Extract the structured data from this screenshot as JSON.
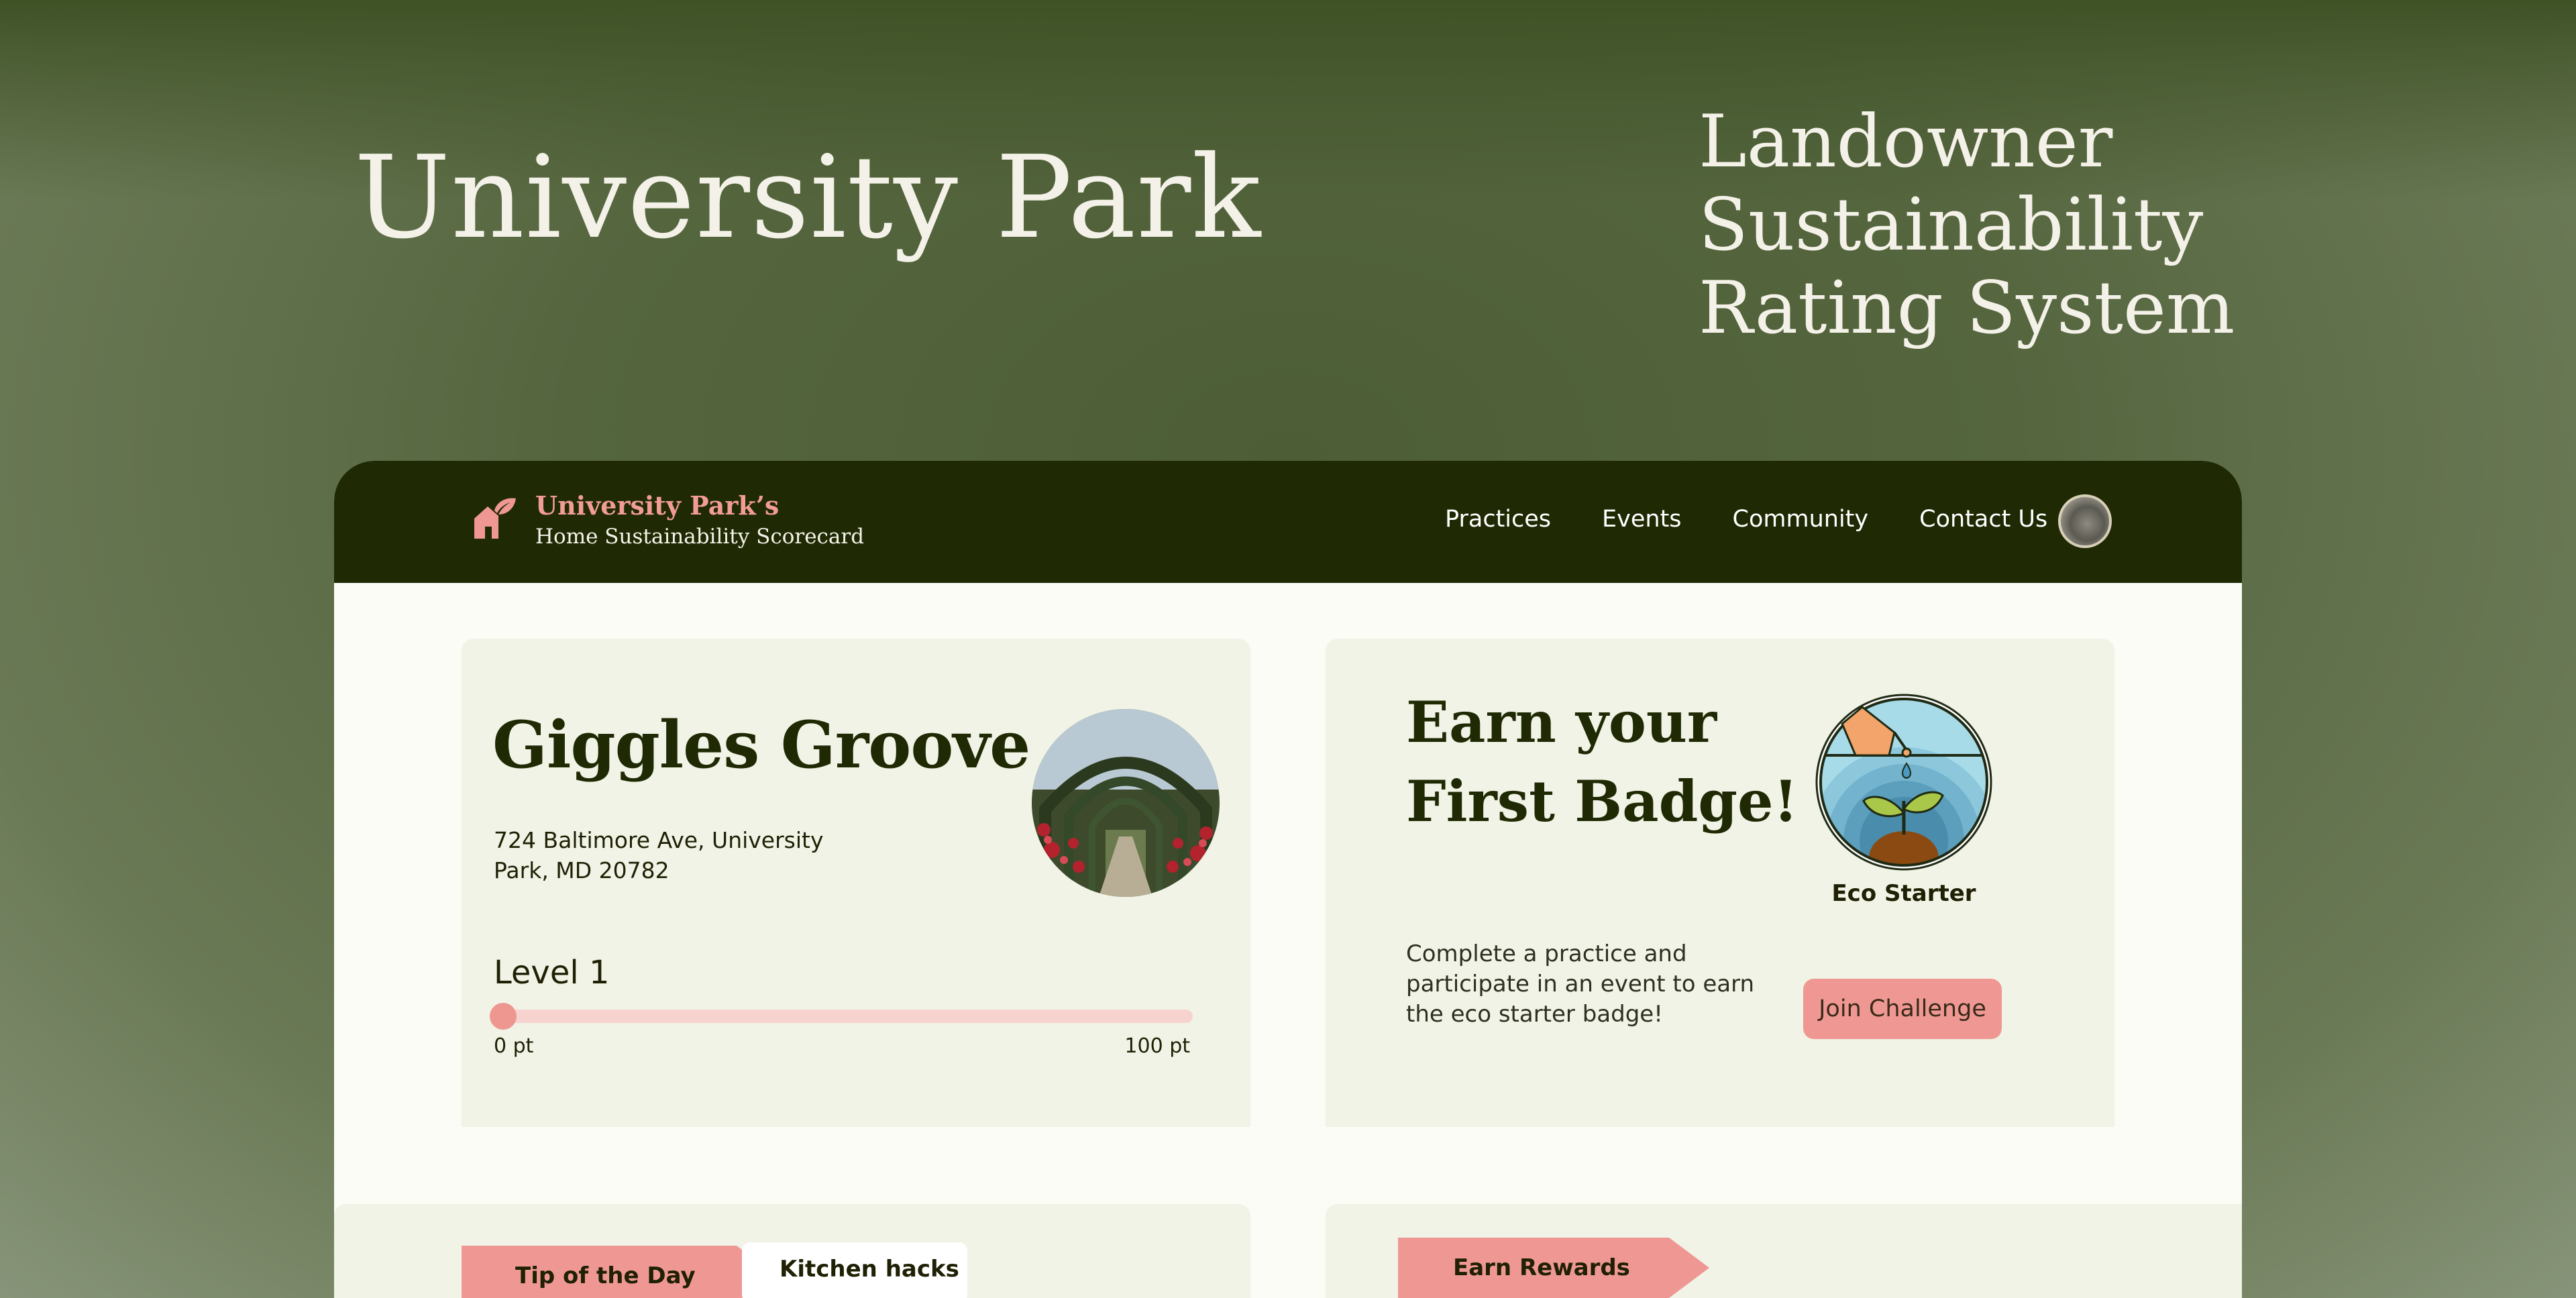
{
  "hero": {
    "title": "University Park",
    "subtitle_lines": [
      "Landowner",
      "Sustainability",
      "Rating System"
    ]
  },
  "navbar": {
    "brand_name": "University Park’s",
    "brand_tagline": "Home Sustainability Scorecard",
    "links": [
      "Practices",
      "Events",
      "Community",
      "Contact Us"
    ]
  },
  "property": {
    "name": "Giggles Groove",
    "address": "724 Baltimore Ave, University Park, MD 20782",
    "level_label": "Level 1",
    "progress_fraction": 0,
    "progress_min_label": "0 pt",
    "progress_max_label": "100 pt"
  },
  "badge": {
    "heading_lines": [
      "Earn your",
      "First Badge!"
    ],
    "badge_name": "Eco Starter",
    "description": "Complete a practice and participate in an event to earn the eco starter badge!",
    "button_label": "Join Challenge"
  },
  "tip": {
    "ribbon_label": "Tip of the Day",
    "topic": "Kitchen hacks"
  },
  "rewards": {
    "ribbon_label": "Earn Rewards"
  },
  "colors": {
    "nav_bg": "#1f2a04",
    "accent_pink": "#ef9893",
    "card_bg": "#f0f3e5",
    "heading_green": "#1f2a04"
  },
  "icons": {
    "brand": "house-leaf-icon",
    "badge": "eco-starter-badge-icon",
    "avatar": "user-avatar"
  }
}
